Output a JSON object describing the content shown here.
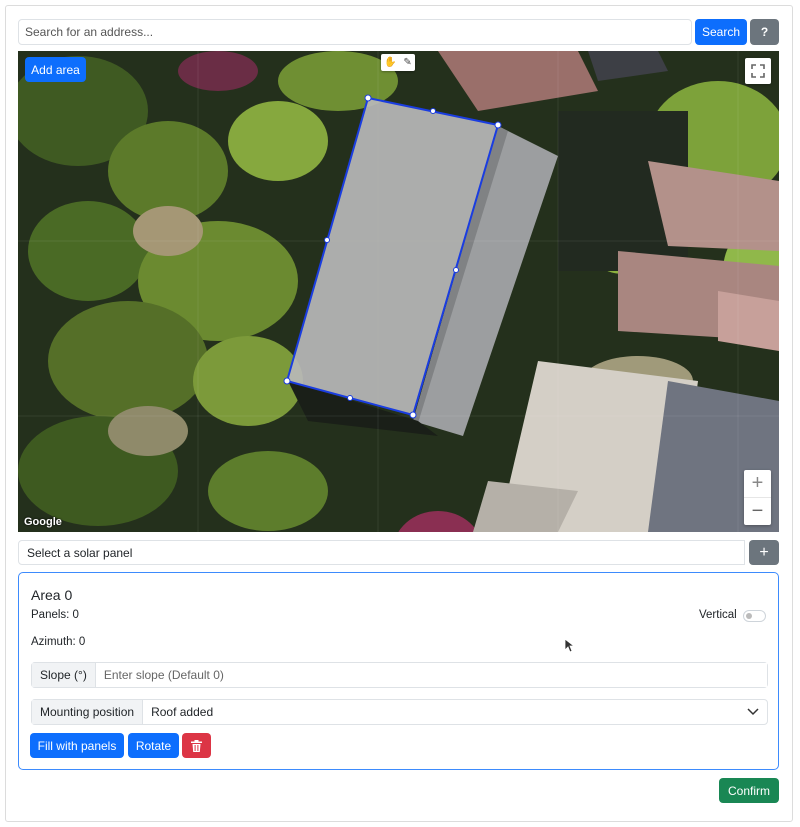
{
  "search": {
    "placeholder": "Search for an address...",
    "search_label": "Search",
    "help_label": "?"
  },
  "map": {
    "add_area_label": "Add area",
    "google_label": "Google",
    "zoom_in_label": "+",
    "zoom_out_label": "−",
    "fullscreen_icon": "fullscreen-icon",
    "hand_icon": "✋",
    "polygon_icon": "✎"
  },
  "panel_select": {
    "placeholder": "Select a solar panel",
    "add_label": "+"
  },
  "area": {
    "title": "Area 0",
    "panels_text": "Panels: 0",
    "azimuth_text": "Azimuth: 0",
    "vertical_label": "Vertical",
    "slope_label": "Slope (°)",
    "slope_placeholder": "Enter slope (Default 0)",
    "mounting_label": "Mounting position",
    "mounting_value": "Roof added",
    "fill_label": "Fill with panels",
    "rotate_label": "Rotate"
  },
  "confirm_label": "Confirm",
  "colors": {
    "primary": "#0d6efd",
    "secondary": "#6c757d",
    "danger": "#dc3545",
    "success": "#198754",
    "polygon": "#1a3de0"
  }
}
